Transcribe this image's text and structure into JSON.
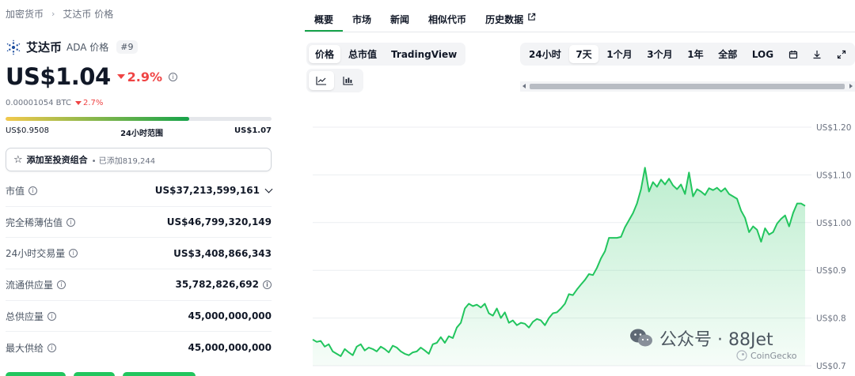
{
  "breadcrumb": {
    "root": "加密货币",
    "current": "艾达币 价格"
  },
  "coin": {
    "name": "艾达币",
    "symbol": "ADA 价格",
    "rank": "#9"
  },
  "price": {
    "value": "US$1.04",
    "change": "2.9%",
    "btc_value": "0.00001054 BTC",
    "btc_change": "2.7%"
  },
  "range": {
    "low": "US$0.9508",
    "label": "24小时范围",
    "high": "US$1.07",
    "position_pct": 69
  },
  "portfolio": {
    "label": "添加至投资组合",
    "added": "• 已添加819,244"
  },
  "stats": [
    {
      "label": "市值",
      "value": "US$37,213,599,161"
    },
    {
      "label": "完全稀薄估值",
      "value": "US$46,799,320,149"
    },
    {
      "label": "24小时交易量",
      "value": "US$3,408,866,343"
    },
    {
      "label": "流通供应量",
      "value": "35,782,826,692"
    },
    {
      "label": "总供应量",
      "value": "45,000,000,000"
    },
    {
      "label": "最大供给",
      "value": "45,000,000,000"
    }
  ],
  "tabs": [
    "概要",
    "市场",
    "新闻",
    "相似代币",
    "历史数据"
  ],
  "chart_type_options": [
    "价格",
    "总市值",
    "TradingView"
  ],
  "time_options": [
    "24小时",
    "7天",
    "1个月",
    "3个月",
    "1年",
    "全部",
    "LOG"
  ],
  "active_time": "7天",
  "watermark": {
    "main": "公众号 · 88Jet",
    "sub": "CoinGecko"
  },
  "colors": {
    "accent": "#16a34a",
    "down": "#ef4444",
    "line": "#22c55e"
  },
  "chart_data": {
    "type": "area",
    "title": "",
    "xlabel": "",
    "ylabel": "",
    "ylim": [
      0.7,
      1.2
    ],
    "yticks": [
      "US$1.20",
      "US$1.10",
      "US$1.00",
      "US$0.9",
      "US$0.8",
      "US$0.7"
    ],
    "ytick_values": [
      1.2,
      1.1,
      1.0,
      0.9,
      0.8,
      0.7
    ],
    "grid": true,
    "series": [
      {
        "values": [
          0.755,
          0.75,
          0.752,
          0.74,
          0.745,
          0.73,
          0.725,
          0.72,
          0.735,
          0.728,
          0.722,
          0.74,
          0.745,
          0.732,
          0.738,
          0.735,
          0.73,
          0.74,
          0.735,
          0.728,
          0.742,
          0.738,
          0.73,
          0.725,
          0.722,
          0.728,
          0.73,
          0.738,
          0.732,
          0.725,
          0.745,
          0.748,
          0.76,
          0.748,
          0.762,
          0.758,
          0.78,
          0.79,
          0.82,
          0.83,
          0.825,
          0.828,
          0.822,
          0.83,
          0.81,
          0.805,
          0.82,
          0.8,
          0.812,
          0.79,
          0.795,
          0.785,
          0.79,
          0.788,
          0.78,
          0.792,
          0.798,
          0.795,
          0.785,
          0.8,
          0.81,
          0.812,
          0.82,
          0.83,
          0.85,
          0.848,
          0.86,
          0.87,
          0.88,
          0.892,
          0.89,
          0.905,
          0.925,
          0.94,
          0.968,
          0.968,
          0.968,
          0.97,
          0.99,
          1.005,
          1.02,
          1.04,
          1.07,
          1.115,
          1.065,
          1.085,
          1.075,
          1.09,
          1.08,
          1.092,
          1.078,
          1.07,
          1.08,
          1.06,
          1.105,
          1.055,
          1.07,
          1.065,
          1.058,
          1.072,
          1.068,
          1.073,
          1.065,
          1.072,
          1.06,
          1.055,
          1.05,
          1.025,
          1.01,
          0.98,
          0.992,
          0.985,
          0.96,
          0.988,
          0.975,
          0.98,
          0.998,
          1.008,
          1.015,
          0.992,
          1.02,
          1.04,
          1.04,
          1.035
        ]
      }
    ]
  }
}
